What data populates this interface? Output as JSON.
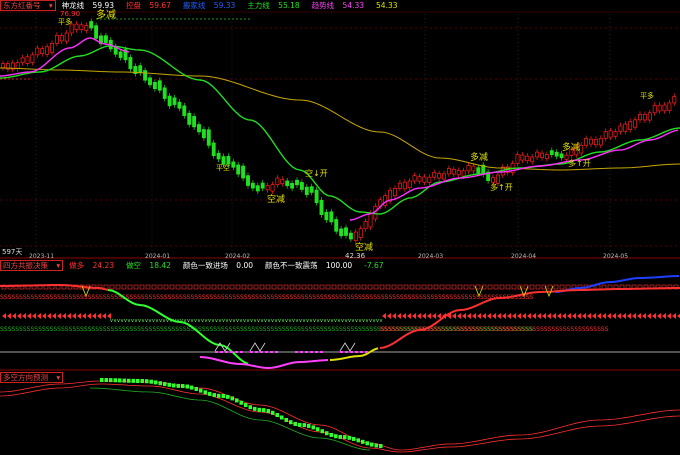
{
  "main_panel": {
    "indicator_name": "东方红番号",
    "fields": [
      {
        "label": "神龙线",
        "value": "59.93",
        "color": "#ffffff"
      },
      {
        "label": "控盘",
        "value": "59.67",
        "color": "#ff3030"
      },
      {
        "label": "搬家线",
        "value": "59.33",
        "color": "#2060ff"
      },
      {
        "label": "主力线",
        "value": "55.18",
        "color": "#20e020"
      },
      {
        "label": "趋势线",
        "value": "54.33",
        "color": "#ff40ff"
      },
      {
        "label": "",
        "value": "54.33",
        "color": "#e0e000"
      }
    ],
    "price_high_label": "76.90",
    "price_low_label": "42.36",
    "level_marker_label": "平多",
    "left_label": "597天",
    "date_labels": [
      "2023-11",
      "2024-01",
      "2024-02",
      "2024-03",
      "2024-04",
      "2024-05"
    ],
    "signals": {
      "duo_jian": "多减",
      "kong_jian": "空减",
      "kong_kai": "空↓开",
      "duo_kai": "多↑开",
      "ping_kong": "平空",
      "ping_duo": "平多"
    }
  },
  "sub_panel_1": {
    "indicator_name": "四方共振决策",
    "fields": [
      {
        "label": "做多",
        "value": "24.23",
        "color": "#ff3030"
      },
      {
        "label": "做空",
        "value": "18.42",
        "color": "#20e020"
      },
      {
        "label": "颜色一致进场",
        "value": "0.00",
        "color": "#ffffff"
      },
      {
        "label": "颜色不一致震荡",
        "value": "100.00",
        "color": "#ffffff"
      },
      {
        "label": "",
        "value": "-7.67",
        "color": "#20e020"
      }
    ]
  },
  "sub_panel_2": {
    "indicator_name": "多空方向预测"
  },
  "colors": {
    "up": "#ff2020",
    "down": "#20e020",
    "trend_green": "#22dd22",
    "trend_magenta": "#ff30ff",
    "long_line": "#c8a800",
    "blue": "#2040ff",
    "dashed_red": "#aa0000"
  }
}
